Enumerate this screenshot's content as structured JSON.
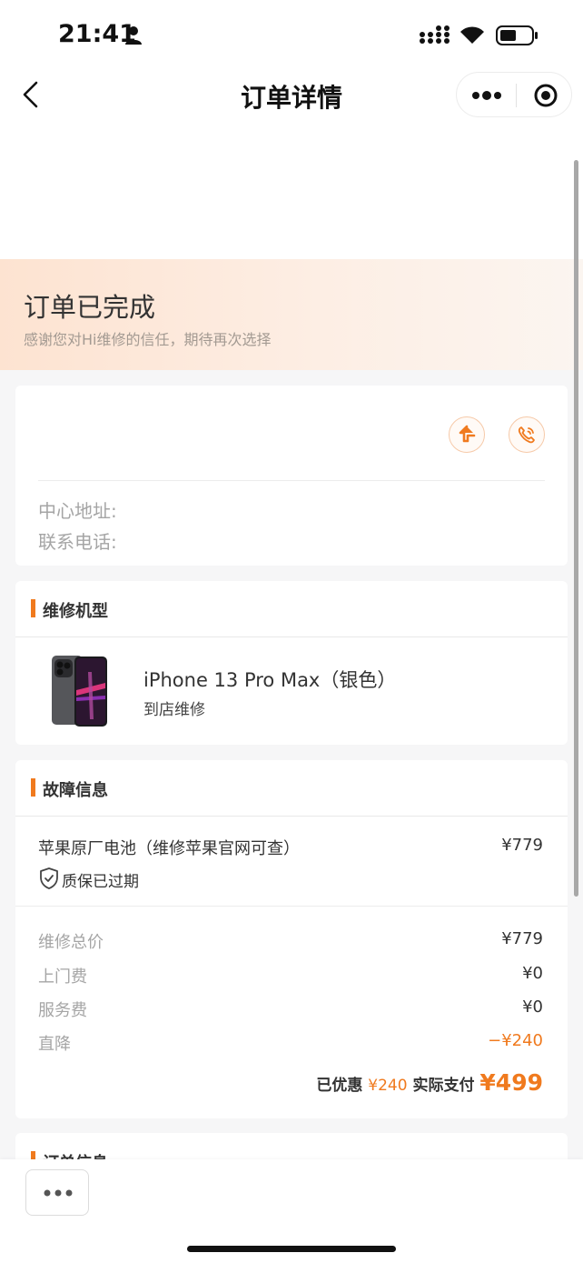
{
  "status_bar": {
    "time": "21:41"
  },
  "nav": {
    "title": "订单详情"
  },
  "banner": {
    "title": "订单已完成",
    "subtitle": "感谢您对Hi维修的信任，期待再次选择"
  },
  "store": {
    "address_label": "中心地址:",
    "phone_label": "联系电话:"
  },
  "model_section": {
    "title": "维修机型",
    "model_name": "iPhone 13 Pro Max（银色）",
    "service_type": "到店维修"
  },
  "fault_section": {
    "title": "故障信息",
    "item_name": "苹果原厂电池（维修苹果官网可查）",
    "item_price": "¥779",
    "warranty": "质保已过期",
    "fees": [
      {
        "label": "维修总价",
        "value": "¥779"
      },
      {
        "label": "上门费",
        "value": "¥0"
      },
      {
        "label": "服务费",
        "value": "¥0"
      },
      {
        "label": "直降",
        "value": "−¥240"
      }
    ],
    "discount_label": "已优惠",
    "discount_value": "¥240",
    "paid_label": "实际支付",
    "paid_value": "¥499"
  },
  "order_section": {
    "title": "订单信息"
  },
  "colors": {
    "accent": "#f07a1e",
    "banner_start": "#fde3d1"
  },
  "icons": [
    "person-icon",
    "signal-icon",
    "wifi-icon",
    "battery-icon",
    "back-icon",
    "more-icon",
    "target-icon",
    "navigate-icon",
    "phone-icon",
    "shield-icon",
    "dots-icon"
  ]
}
